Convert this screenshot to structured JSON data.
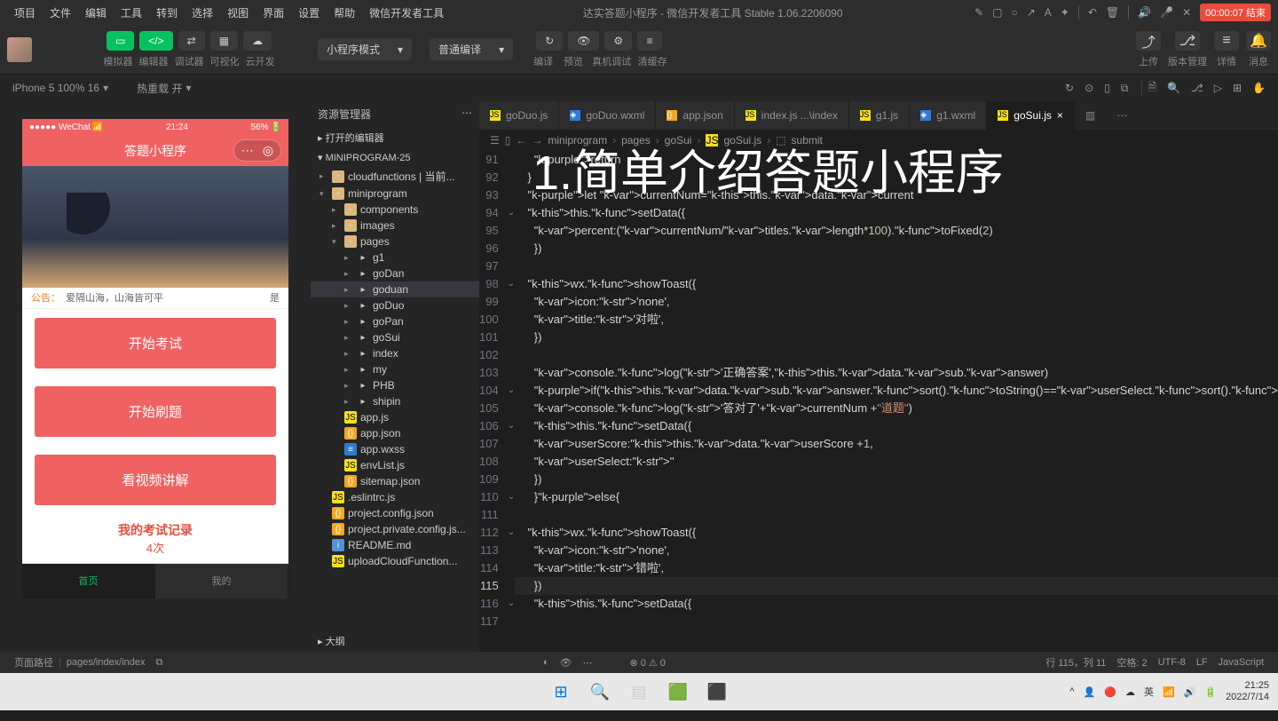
{
  "menubar": {
    "items": [
      "项目",
      "文件",
      "编辑",
      "工具",
      "转到",
      "选择",
      "视图",
      "界面",
      "设置",
      "帮助",
      "微信开发者工具"
    ],
    "title": "达实答题小程序 - 微信开发者工具 Stable 1.06.2206090",
    "recording": "00:00:07 结束"
  },
  "toolbar": {
    "group1_labels": [
      "模拟器",
      "编辑器",
      "调试器",
      "可视化",
      "云开发"
    ],
    "dropdown1": "小程序模式",
    "dropdown2": "普通编译",
    "compile_labels": [
      "编译",
      "预览",
      "真机调试",
      "清缓存"
    ],
    "right_labels": [
      "上传",
      "版本管理",
      "详情",
      "消息"
    ]
  },
  "simbar": {
    "device": "iPhone 5 100% 16",
    "hot": "热重载 开"
  },
  "phone": {
    "carrier": "●●●●● WeChat",
    "time": "21:24",
    "battery": "56%",
    "title": "答题小程序",
    "announce_tag": "公告：",
    "announce_text": "爱隔山海，山海皆可平",
    "announce_right": "是",
    "btn1": "开始考试",
    "btn2": "开始刷题",
    "btn3": "看视频讲解",
    "record_title": "我的考试记录",
    "record_count": "4次",
    "tab1": "首页",
    "tab2": "我的"
  },
  "explorer": {
    "title": "资源管理器",
    "section1": "打开的编辑器",
    "project": "MINIPROGRAM-25",
    "tree": [
      {
        "depth": 0,
        "arrow": "▸",
        "icon": "folder",
        "label": "cloudfunctions | 当前...",
        "type": "dir"
      },
      {
        "depth": 0,
        "arrow": "▾",
        "icon": "folder",
        "label": "miniprogram",
        "type": "dir"
      },
      {
        "depth": 1,
        "arrow": "▸",
        "icon": "folder",
        "label": "components",
        "type": "dir"
      },
      {
        "depth": 1,
        "arrow": "▸",
        "icon": "folder",
        "label": "images",
        "type": "dir"
      },
      {
        "depth": 1,
        "arrow": "▾",
        "icon": "folder",
        "label": "pages",
        "type": "dir"
      },
      {
        "depth": 2,
        "arrow": "▸",
        "icon": "dir",
        "label": "g1",
        "type": "dir"
      },
      {
        "depth": 2,
        "arrow": "▸",
        "icon": "dir",
        "label": "goDan",
        "type": "dir"
      },
      {
        "depth": 2,
        "arrow": "▸",
        "icon": "dir",
        "label": "goduan",
        "type": "dir",
        "selected": true
      },
      {
        "depth": 2,
        "arrow": "▸",
        "icon": "dir",
        "label": "goDuo",
        "type": "dir"
      },
      {
        "depth": 2,
        "arrow": "▸",
        "icon": "dir",
        "label": "goPan",
        "type": "dir"
      },
      {
        "depth": 2,
        "arrow": "▸",
        "icon": "dir",
        "label": "goSui",
        "type": "dir"
      },
      {
        "depth": 2,
        "arrow": "▸",
        "icon": "dir",
        "label": "index",
        "type": "dir"
      },
      {
        "depth": 2,
        "arrow": "▸",
        "icon": "dir",
        "label": "my",
        "type": "dir"
      },
      {
        "depth": 2,
        "arrow": "▸",
        "icon": "dir",
        "label": "PHB",
        "type": "dir"
      },
      {
        "depth": 2,
        "arrow": "▸",
        "icon": "dir",
        "label": "shipin",
        "type": "dir"
      },
      {
        "depth": 1,
        "arrow": "",
        "icon": "js",
        "label": "app.js",
        "type": "file"
      },
      {
        "depth": 1,
        "arrow": "",
        "icon": "json",
        "label": "app.json",
        "type": "file"
      },
      {
        "depth": 1,
        "arrow": "",
        "icon": "wxss",
        "label": "app.wxss",
        "type": "file"
      },
      {
        "depth": 1,
        "arrow": "",
        "icon": "js",
        "label": "envList.js",
        "type": "file"
      },
      {
        "depth": 1,
        "arrow": "",
        "icon": "json",
        "label": "sitemap.json",
        "type": "file"
      },
      {
        "depth": 0,
        "arrow": "",
        "icon": "js",
        "label": ".eslintrc.js",
        "type": "file"
      },
      {
        "depth": 0,
        "arrow": "",
        "icon": "json",
        "label": "project.config.json",
        "type": "file"
      },
      {
        "depth": 0,
        "arrow": "",
        "icon": "json",
        "label": "project.private.config.js...",
        "type": "file"
      },
      {
        "depth": 0,
        "arrow": "",
        "icon": "md",
        "label": "README.md",
        "type": "file"
      },
      {
        "depth": 0,
        "arrow": "",
        "icon": "js",
        "label": "uploadCloudFunction...",
        "type": "file"
      }
    ],
    "outline": "大纲"
  },
  "tabs": [
    {
      "icon": "js",
      "label": "goDuo.js"
    },
    {
      "icon": "wxss",
      "label": "goDuo.wxml"
    },
    {
      "icon": "json",
      "label": "app.json"
    },
    {
      "icon": "js",
      "label": "index.js ...\\index"
    },
    {
      "icon": "js",
      "label": "g1.js"
    },
    {
      "icon": "wxss",
      "label": "g1.wxml"
    },
    {
      "icon": "js",
      "label": "goSui.js",
      "active": true
    }
  ],
  "breadcrumb": [
    "miniprogram",
    "pages",
    "goSui",
    "goSui.js",
    "submit"
  ],
  "overlay": "1.简单介绍答题小程序",
  "code": {
    "start": 91,
    "lines": [
      {
        "t": "      return"
      },
      {
        "t": "    }"
      },
      {
        "t": "    let currentNum=this.data.current"
      },
      {
        "t": "    this.setData({",
        "fold": true
      },
      {
        "t": "      percent:(currentNum/titles.length*100).toFixed(2)"
      },
      {
        "t": "      })"
      },
      {
        "t": ""
      },
      {
        "t": "    wx.showToast({",
        "fold": true
      },
      {
        "t": "      icon:'none',"
      },
      {
        "t": "      title:'对啦',"
      },
      {
        "t": "      })"
      },
      {
        "t": ""
      },
      {
        "t": "      console.log('正确答案',this.data.sub.answer)"
      },
      {
        "t": "      if(this.data.sub.answer.sort().toString()==userSelect.sort().toString()){",
        "fold": true
      },
      {
        "t": "      console.log('答对了'+currentNum +\"道题\")"
      },
      {
        "t": "      this.setData({",
        "fold": true
      },
      {
        "t": "      userScore:this.data.userScore +1,"
      },
      {
        "t": "      userSelect:''"
      },
      {
        "t": "      })"
      },
      {
        "t": "      }else{",
        "fold": true
      },
      {
        "t": ""
      },
      {
        "t": "    wx.showToast({",
        "fold": true
      },
      {
        "t": "      icon:'none',"
      },
      {
        "t": "      title:'错啦',"
      },
      {
        "t": "      })",
        "active": true
      },
      {
        "t": "      this.setData({",
        "fold": true
      },
      {
        "t": ""
      }
    ]
  },
  "statusbar": {
    "left1": "页面路径",
    "left2": "pages/index/index",
    "errors": "⊗ 0 ⚠ 0",
    "pos": "行 115，列 11",
    "spaces": "空格: 2",
    "encoding": "UTF-8",
    "eol": "LF",
    "lang": "JavaScript"
  },
  "taskbar": {
    "time": "21:25",
    "date": "2022/7/14",
    "ime": "英"
  }
}
